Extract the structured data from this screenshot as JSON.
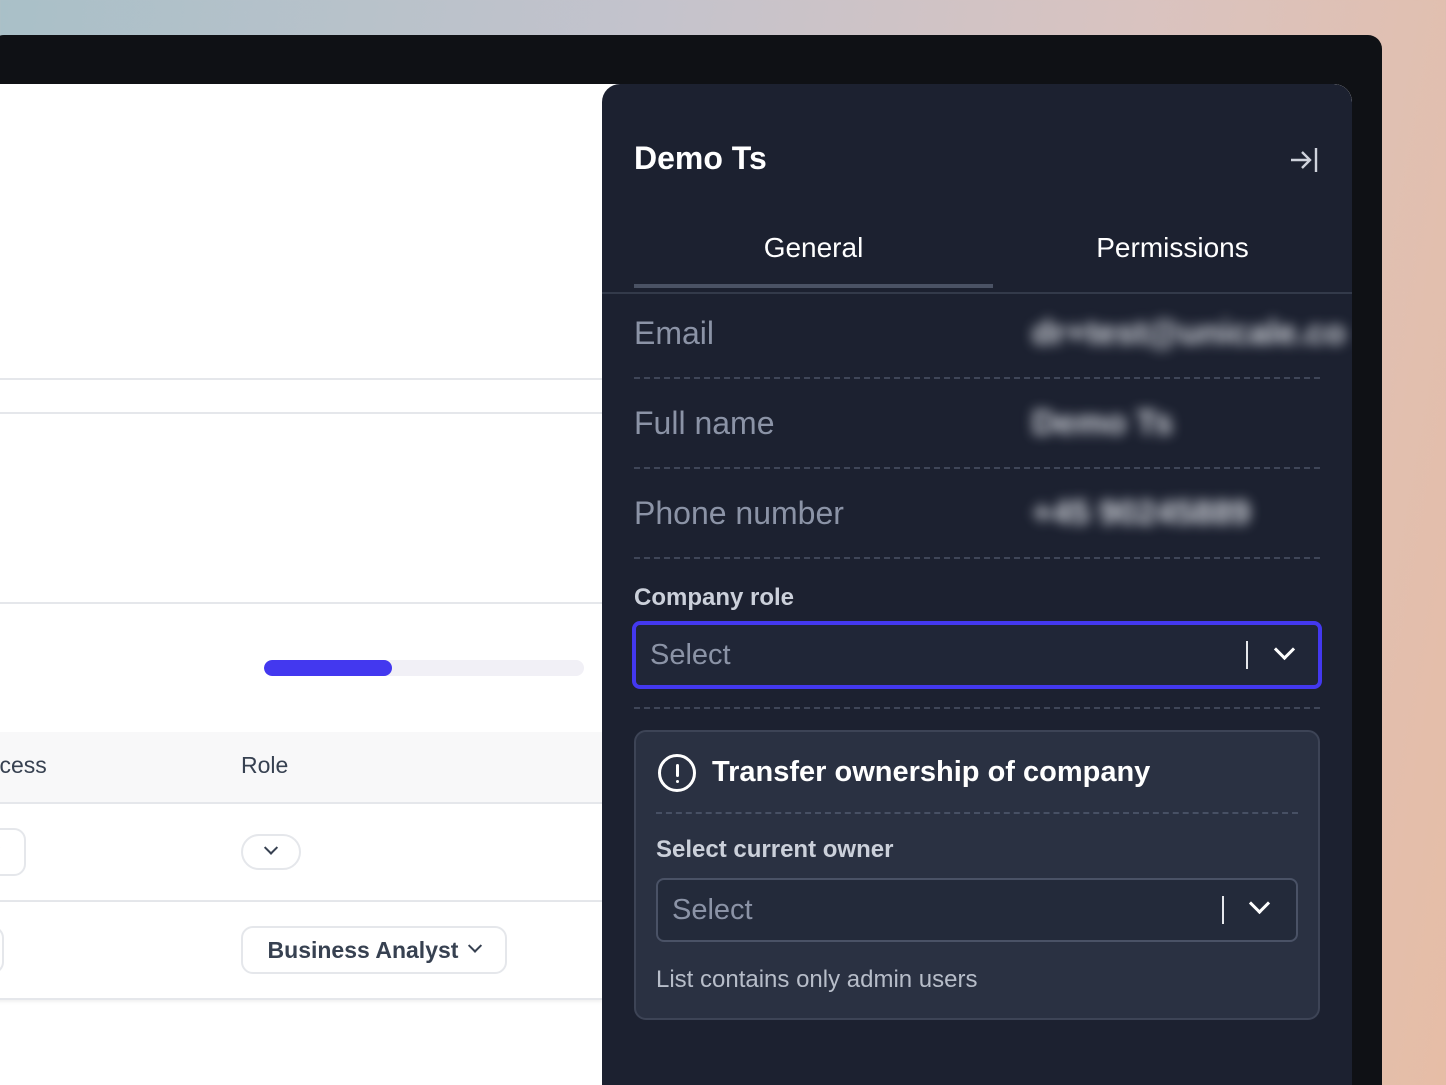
{
  "panel": {
    "title": "Demo Ts",
    "tabs": [
      {
        "label": "General",
        "active": true
      },
      {
        "label": "Permissions",
        "active": false
      }
    ],
    "fields": [
      {
        "label": "Email",
        "value": "dr+test@unicale.co"
      },
      {
        "label": "Full name",
        "value": "Demo Ts"
      },
      {
        "label": "Phone number",
        "value": "+45 90245889"
      }
    ],
    "company_role": {
      "label": "Company role",
      "placeholder": "Select"
    },
    "transfer": {
      "title": "Transfer ownership of company",
      "owner_label": "Select current owner",
      "owner_placeholder": "Select",
      "helper": "List contains only admin users"
    }
  },
  "background": {
    "progress": 0.4,
    "table_headers": [
      "ccess",
      "Role"
    ],
    "rows": [
      {
        "role": ""
      },
      {
        "role": "Business Analyst"
      }
    ]
  },
  "colors": {
    "accent": "#4338ef",
    "panel_bg": "#1c2130",
    "card_bg": "#2a3142"
  }
}
